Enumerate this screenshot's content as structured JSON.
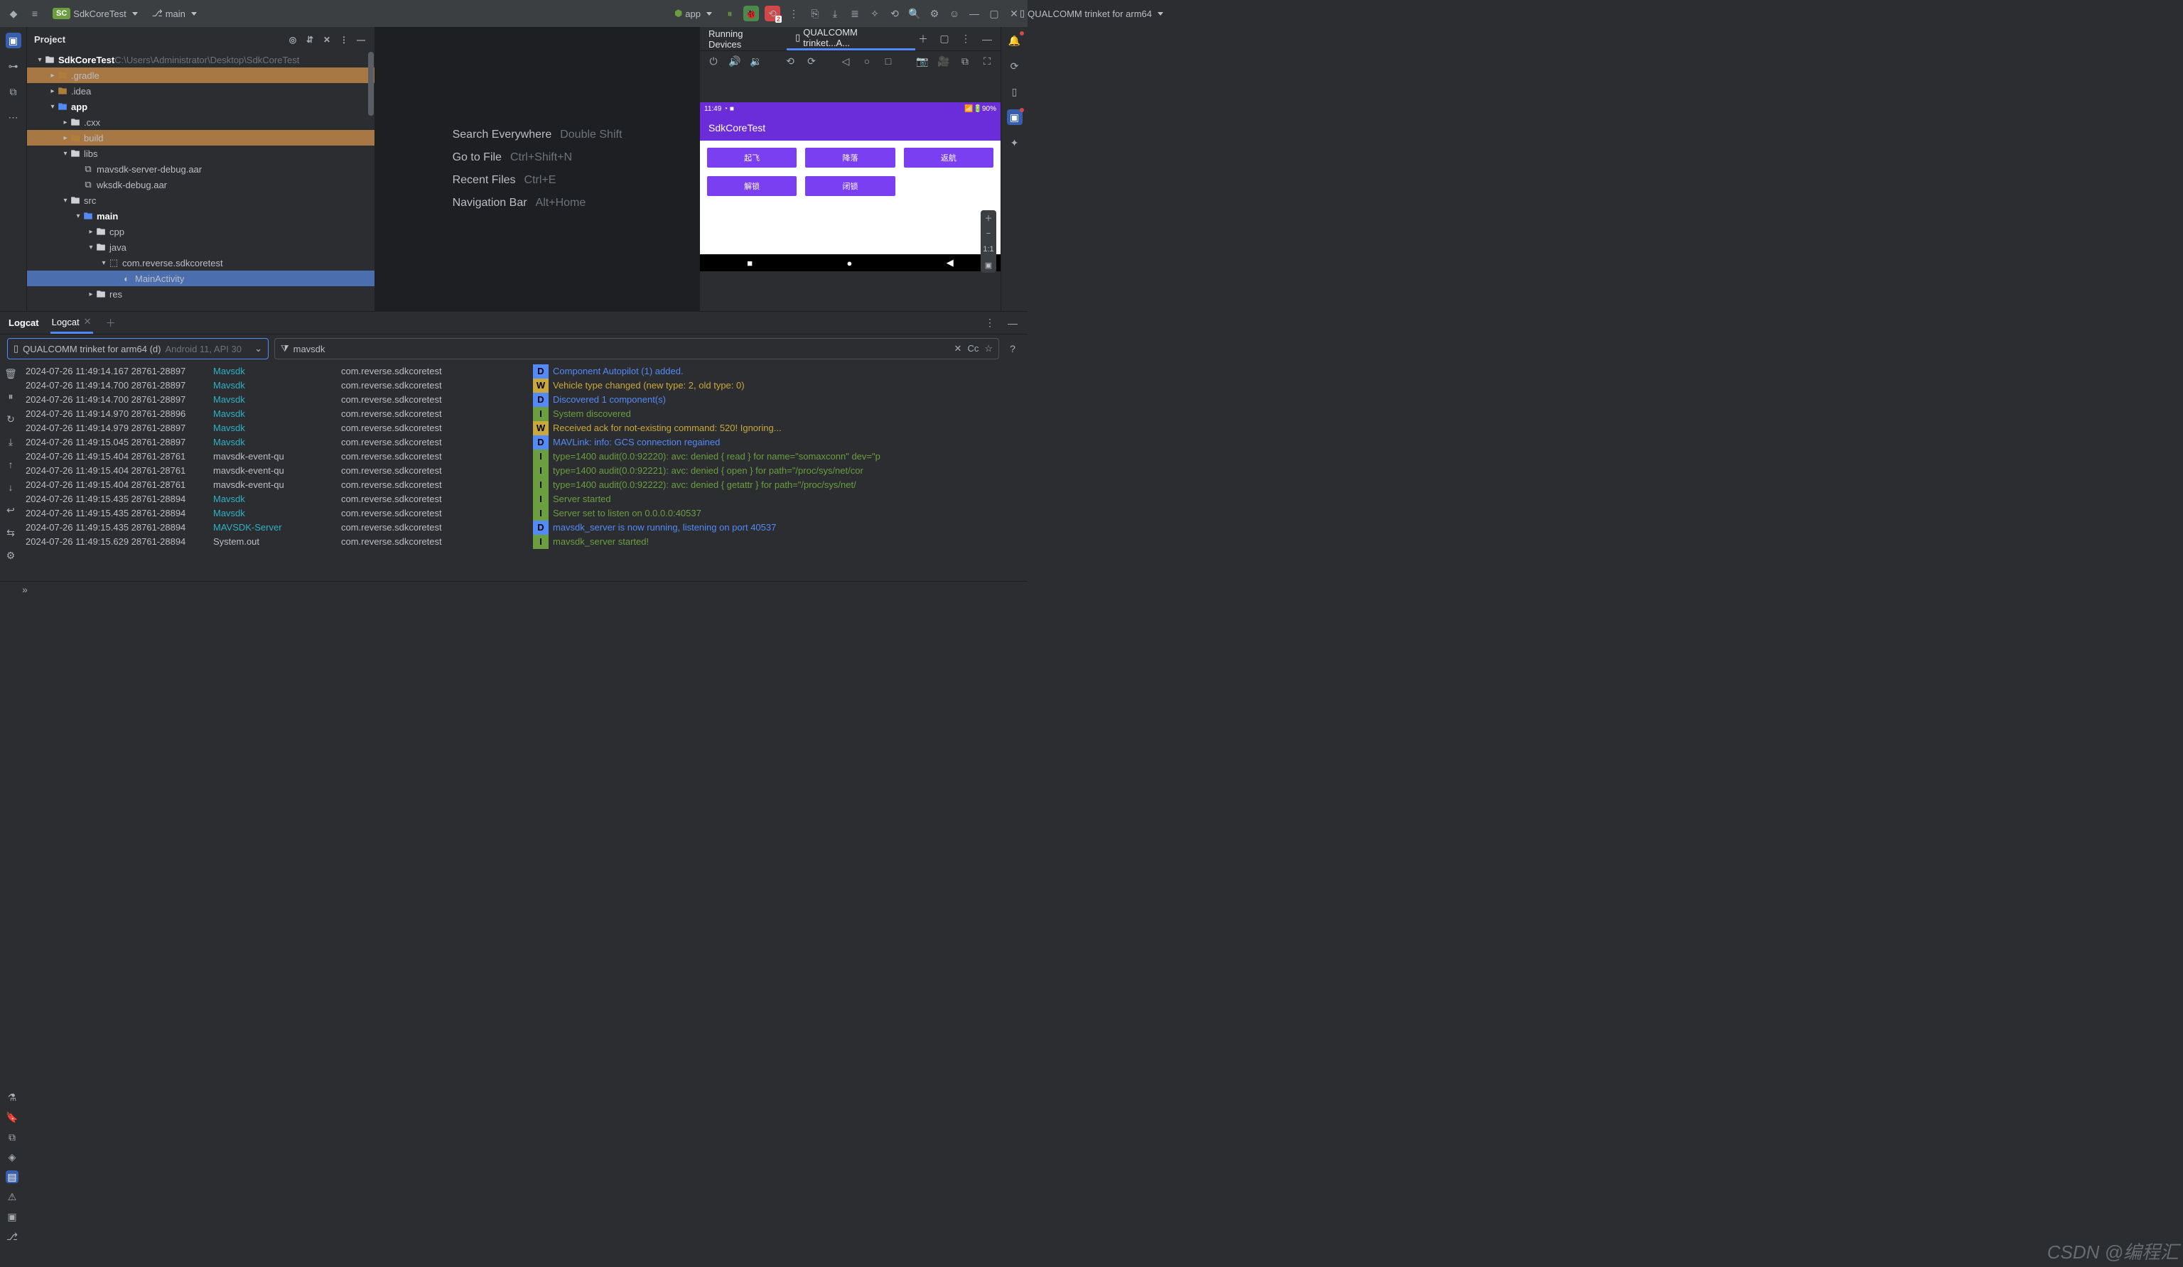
{
  "titlebar": {
    "project_badge": "SC",
    "project_name": "SdkCoreTest",
    "branch_name": "main",
    "device_label": "QUALCOMM trinket for arm64",
    "run_config": "app"
  },
  "project_pane": {
    "title": "Project",
    "root_name": "SdkCoreTest",
    "root_path": "C:\\Users\\Administrator\\Desktop\\SdkCoreTest",
    "nodes": {
      "gradle": ".gradle",
      "idea": ".idea",
      "app": "app",
      "cxx": ".cxx",
      "build": "build",
      "libs": "libs",
      "aar1": "mavsdk-server-debug.aar",
      "aar2": "wksdk-debug.aar",
      "src": "src",
      "main": "main",
      "cpp": "cpp",
      "java": "java",
      "pkg": "com.reverse.sdkcoretest",
      "activity": "MainActivity",
      "res": "res"
    }
  },
  "editor_hints": [
    {
      "label": "Search Everywhere",
      "shortcut": "Double Shift"
    },
    {
      "label": "Go to File",
      "shortcut": "Ctrl+Shift+N"
    },
    {
      "label": "Recent Files",
      "shortcut": "Ctrl+E"
    },
    {
      "label": "Navigation Bar",
      "shortcut": "Alt+Home"
    }
  ],
  "device_panel": {
    "tab_running": "Running Devices",
    "tab_device": "QUALCOMM trinket...A...",
    "phone_time": "11:49",
    "phone_battery": "90%",
    "phone_title": "SdkCoreTest",
    "buttons": [
      "起飞",
      "降落",
      "返航",
      "解锁",
      "闭锁"
    ],
    "zoom_label": "1:1"
  },
  "logcat": {
    "panel_title": "Logcat",
    "tab_label": "Logcat",
    "device_name": "QUALCOMM trinket for arm64 (d)",
    "device_meta": "Android 11, API 30",
    "filter_value": "mavsdk",
    "cc_label": "Cc",
    "rows": [
      {
        "ts": "2024-07-26 11:49:14.167 28761-28897",
        "tag": "Mavsdk",
        "tagc": "c-cyan",
        "pkg": "com.reverse.sdkcoretest",
        "lvl": "D",
        "msg": "Component Autopilot (1) added.",
        "mc": "c-blue"
      },
      {
        "ts": "2024-07-26 11:49:14.700 28761-28897",
        "tag": "Mavsdk",
        "tagc": "c-cyan",
        "pkg": "com.reverse.sdkcoretest",
        "lvl": "W",
        "msg": "Vehicle type changed (new type: 2, old type: 0)",
        "mc": "c-yel"
      },
      {
        "ts": "2024-07-26 11:49:14.700 28761-28897",
        "tag": "Mavsdk",
        "tagc": "c-cyan",
        "pkg": "com.reverse.sdkcoretest",
        "lvl": "D",
        "msg": "Discovered 1 component(s)",
        "mc": "c-blue"
      },
      {
        "ts": "2024-07-26 11:49:14.970 28761-28896",
        "tag": "Mavsdk",
        "tagc": "c-cyan",
        "pkg": "com.reverse.sdkcoretest",
        "lvl": "I",
        "msg": "System discovered",
        "mc": "c-grn"
      },
      {
        "ts": "2024-07-26 11:49:14.979 28761-28897",
        "tag": "Mavsdk",
        "tagc": "c-cyan",
        "pkg": "com.reverse.sdkcoretest",
        "lvl": "W",
        "msg": "Received ack for not-existing command: 520! Ignoring...",
        "mc": "c-yel"
      },
      {
        "ts": "2024-07-26 11:49:15.045 28761-28897",
        "tag": "Mavsdk",
        "tagc": "c-cyan",
        "pkg": "com.reverse.sdkcoretest",
        "lvl": "D",
        "msg": "MAVLink: info: GCS connection regained",
        "mc": "c-blue"
      },
      {
        "ts": "2024-07-26 11:49:15.404 28761-28761",
        "tag": "mavsdk-event-qu",
        "tagc": "",
        "pkg": "com.reverse.sdkcoretest",
        "lvl": "I",
        "msg": "type=1400 audit(0.0:92220): avc: denied { read } for name=\"somaxconn\" dev=\"p",
        "mc": "c-grn"
      },
      {
        "ts": "2024-07-26 11:49:15.404 28761-28761",
        "tag": "mavsdk-event-qu",
        "tagc": "",
        "pkg": "com.reverse.sdkcoretest",
        "lvl": "I",
        "msg": "type=1400 audit(0.0:92221): avc: denied { open } for path=\"/proc/sys/net/cor",
        "mc": "c-grn"
      },
      {
        "ts": "2024-07-26 11:49:15.404 28761-28761",
        "tag": "mavsdk-event-qu",
        "tagc": "",
        "pkg": "com.reverse.sdkcoretest",
        "lvl": "I",
        "msg": "type=1400 audit(0.0:92222): avc: denied { getattr } for path=\"/proc/sys/net/",
        "mc": "c-grn"
      },
      {
        "ts": "2024-07-26 11:49:15.435 28761-28894",
        "tag": "Mavsdk",
        "tagc": "c-cyan",
        "pkg": "com.reverse.sdkcoretest",
        "lvl": "I",
        "msg": "Server started",
        "mc": "c-grn"
      },
      {
        "ts": "2024-07-26 11:49:15.435 28761-28894",
        "tag": "Mavsdk",
        "tagc": "c-cyan",
        "pkg": "com.reverse.sdkcoretest",
        "lvl": "I",
        "msg": "Server set to listen on 0.0.0.0:40537",
        "mc": "c-grn"
      },
      {
        "ts": "2024-07-26 11:49:15.435 28761-28894",
        "tag": "MAVSDK-Server",
        "tagc": "c-cyan",
        "pkg": "com.reverse.sdkcoretest",
        "lvl": "D",
        "msg": "mavsdk_server is now running, listening on port 40537",
        "mc": "c-blue"
      },
      {
        "ts": "2024-07-26 11:49:15.629 28761-28894",
        "tag": "System.out",
        "tagc": "",
        "pkg": "com.reverse.sdkcoretest",
        "lvl": "I",
        "msg": "mavsdk_server started!",
        "mc": "c-grn"
      }
    ]
  },
  "watermark": "CSDN @编程汇"
}
